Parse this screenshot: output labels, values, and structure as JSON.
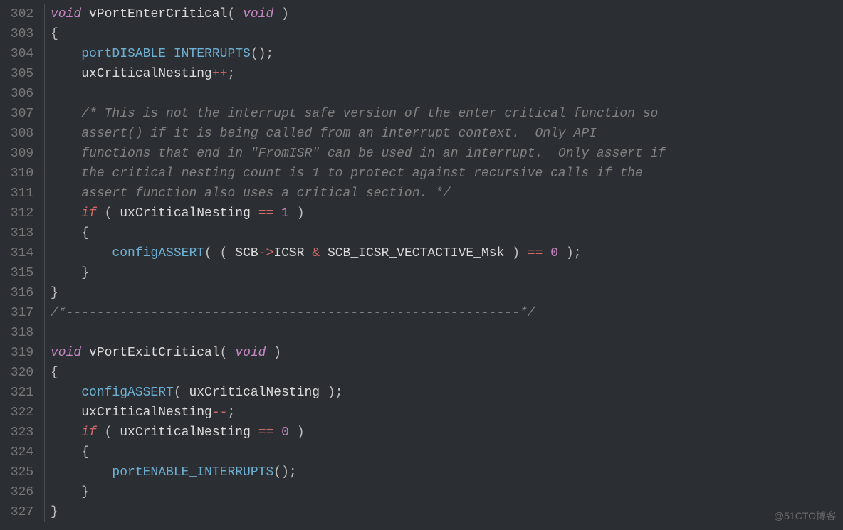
{
  "watermark": "@51CTO博客",
  "startLine": 302,
  "lines": [
    {
      "n": 302,
      "segs": [
        {
          "t": "void",
          "c": "kw-type"
        },
        {
          "t": " ",
          "c": ""
        },
        {
          "t": "vPortEnterCritical",
          "c": "fn-name"
        },
        {
          "t": "( ",
          "c": "punct"
        },
        {
          "t": "void",
          "c": "kw-type"
        },
        {
          "t": " )",
          "c": "punct"
        }
      ]
    },
    {
      "n": 303,
      "segs": [
        {
          "t": "{",
          "c": "punct"
        }
      ]
    },
    {
      "n": 304,
      "segs": [
        {
          "t": "    ",
          "c": ""
        },
        {
          "t": "portDISABLE_INTERRUPTS",
          "c": "fn-call"
        },
        {
          "t": "();",
          "c": "punct"
        }
      ]
    },
    {
      "n": 305,
      "segs": [
        {
          "t": "    ",
          "c": ""
        },
        {
          "t": "uxCriticalNesting",
          "c": "ident"
        },
        {
          "t": "++",
          "c": "op"
        },
        {
          "t": ";",
          "c": "punct"
        }
      ]
    },
    {
      "n": 306,
      "segs": []
    },
    {
      "n": 307,
      "segs": [
        {
          "t": "    ",
          "c": ""
        },
        {
          "t": "/* This is not the interrupt safe version of the enter critical function so",
          "c": "comment"
        }
      ]
    },
    {
      "n": 308,
      "segs": [
        {
          "t": "    ",
          "c": ""
        },
        {
          "t": "assert() if it is being called from an interrupt context.  Only API",
          "c": "comment"
        }
      ]
    },
    {
      "n": 309,
      "segs": [
        {
          "t": "    ",
          "c": ""
        },
        {
          "t": "functions that end in \"FromISR\" can be used in an interrupt.  Only assert if",
          "c": "comment"
        }
      ]
    },
    {
      "n": 310,
      "segs": [
        {
          "t": "    ",
          "c": ""
        },
        {
          "t": "the critical nesting count is 1 to protect against recursive calls if the",
          "c": "comment"
        }
      ]
    },
    {
      "n": 311,
      "segs": [
        {
          "t": "    ",
          "c": ""
        },
        {
          "t": "assert function also uses a critical section. */",
          "c": "comment"
        }
      ]
    },
    {
      "n": 312,
      "segs": [
        {
          "t": "    ",
          "c": ""
        },
        {
          "t": "if",
          "c": "kw-ctrl"
        },
        {
          "t": " ( ",
          "c": "punct"
        },
        {
          "t": "uxCriticalNesting",
          "c": "ident"
        },
        {
          "t": " ",
          "c": ""
        },
        {
          "t": "==",
          "c": "op"
        },
        {
          "t": " ",
          "c": ""
        },
        {
          "t": "1",
          "c": "num"
        },
        {
          "t": " )",
          "c": "punct"
        }
      ]
    },
    {
      "n": 313,
      "segs": [
        {
          "t": "    ",
          "c": ""
        },
        {
          "t": "{",
          "c": "punct"
        }
      ]
    },
    {
      "n": 314,
      "segs": [
        {
          "t": "        ",
          "c": ""
        },
        {
          "t": "configASSERT",
          "c": "fn-call"
        },
        {
          "t": "( ( ",
          "c": "punct"
        },
        {
          "t": "SCB",
          "c": "ident"
        },
        {
          "t": "->",
          "c": "op"
        },
        {
          "t": "ICSR",
          "c": "ident"
        },
        {
          "t": " ",
          "c": ""
        },
        {
          "t": "&",
          "c": "op"
        },
        {
          "t": " ",
          "c": ""
        },
        {
          "t": "SCB_ICSR_VECTACTIVE_Msk",
          "c": "ident"
        },
        {
          "t": " ) ",
          "c": "punct"
        },
        {
          "t": "==",
          "c": "op"
        },
        {
          "t": " ",
          "c": ""
        },
        {
          "t": "0",
          "c": "num"
        },
        {
          "t": " );",
          "c": "punct"
        }
      ]
    },
    {
      "n": 315,
      "segs": [
        {
          "t": "    ",
          "c": ""
        },
        {
          "t": "}",
          "c": "punct"
        }
      ]
    },
    {
      "n": 316,
      "segs": [
        {
          "t": "}",
          "c": "punct"
        }
      ]
    },
    {
      "n": 317,
      "segs": [
        {
          "t": "/*-----------------------------------------------------------*/",
          "c": "comment"
        }
      ]
    },
    {
      "n": 318,
      "segs": []
    },
    {
      "n": 319,
      "segs": [
        {
          "t": "void",
          "c": "kw-type"
        },
        {
          "t": " ",
          "c": ""
        },
        {
          "t": "vPortExitCritical",
          "c": "fn-name"
        },
        {
          "t": "( ",
          "c": "punct"
        },
        {
          "t": "void",
          "c": "kw-type"
        },
        {
          "t": " )",
          "c": "punct"
        }
      ]
    },
    {
      "n": 320,
      "segs": [
        {
          "t": "{",
          "c": "punct"
        }
      ]
    },
    {
      "n": 321,
      "segs": [
        {
          "t": "    ",
          "c": ""
        },
        {
          "t": "configASSERT",
          "c": "fn-call"
        },
        {
          "t": "( ",
          "c": "punct"
        },
        {
          "t": "uxCriticalNesting",
          "c": "ident"
        },
        {
          "t": " );",
          "c": "punct"
        }
      ]
    },
    {
      "n": 322,
      "segs": [
        {
          "t": "    ",
          "c": ""
        },
        {
          "t": "uxCriticalNesting",
          "c": "ident"
        },
        {
          "t": "--",
          "c": "op"
        },
        {
          "t": ";",
          "c": "punct"
        }
      ]
    },
    {
      "n": 323,
      "segs": [
        {
          "t": "    ",
          "c": ""
        },
        {
          "t": "if",
          "c": "kw-ctrl"
        },
        {
          "t": " ( ",
          "c": "punct"
        },
        {
          "t": "uxCriticalNesting",
          "c": "ident"
        },
        {
          "t": " ",
          "c": ""
        },
        {
          "t": "==",
          "c": "op"
        },
        {
          "t": " ",
          "c": ""
        },
        {
          "t": "0",
          "c": "num"
        },
        {
          "t": " )",
          "c": "punct"
        }
      ]
    },
    {
      "n": 324,
      "segs": [
        {
          "t": "    ",
          "c": ""
        },
        {
          "t": "{",
          "c": "punct"
        }
      ]
    },
    {
      "n": 325,
      "segs": [
        {
          "t": "        ",
          "c": ""
        },
        {
          "t": "portENABLE_INTERRUPTS",
          "c": "fn-call"
        },
        {
          "t": "();",
          "c": "punct"
        }
      ]
    },
    {
      "n": 326,
      "segs": [
        {
          "t": "    ",
          "c": ""
        },
        {
          "t": "}",
          "c": "punct"
        }
      ]
    },
    {
      "n": 327,
      "segs": [
        {
          "t": "}",
          "c": "punct"
        }
      ]
    }
  ]
}
